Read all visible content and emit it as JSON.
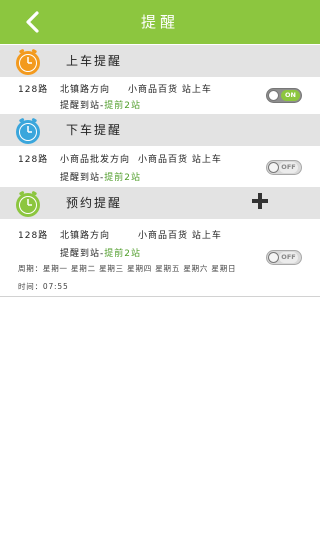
{
  "header": {
    "title": "提醒"
  },
  "sections": {
    "boarding": {
      "label": "上车提醒",
      "route": "128路",
      "direction": "北镇路方向",
      "stop": "小商品百货 站上车",
      "advance_label": "提醒到站-",
      "advance_value": "提前2站",
      "toggle_text": "ON",
      "clock_color": "#f39a1e"
    },
    "alighting": {
      "label": "下车提醒",
      "route": "128路",
      "direction": "小商品批发方向",
      "stop": "小商品百货 站上车",
      "advance_label": "提醒到站-",
      "advance_value": "提前2站",
      "toggle_text": "OFF",
      "clock_color": "#3aa6dc"
    },
    "scheduled": {
      "label": "预约提醒",
      "route": "128路",
      "direction": "北镇路方向",
      "stop": "小商品百货 站上车",
      "advance_label": "提醒到站-",
      "advance_value": "提前2站",
      "weekdays": "周期：星期一 星期二 星期三 星期四 星期五 星期六 星期日",
      "time": "时间：07:55",
      "toggle_text": "OFF",
      "clock_color": "#8cc63f"
    }
  },
  "colors": {
    "header": "#8cc63f",
    "accent_text": "#4f9d2a",
    "section_bg": "#e3e3e3"
  },
  "icons": {
    "back": "chevron-left-icon",
    "clock": "alarm-clock-icon",
    "add": "plus-icon"
  }
}
